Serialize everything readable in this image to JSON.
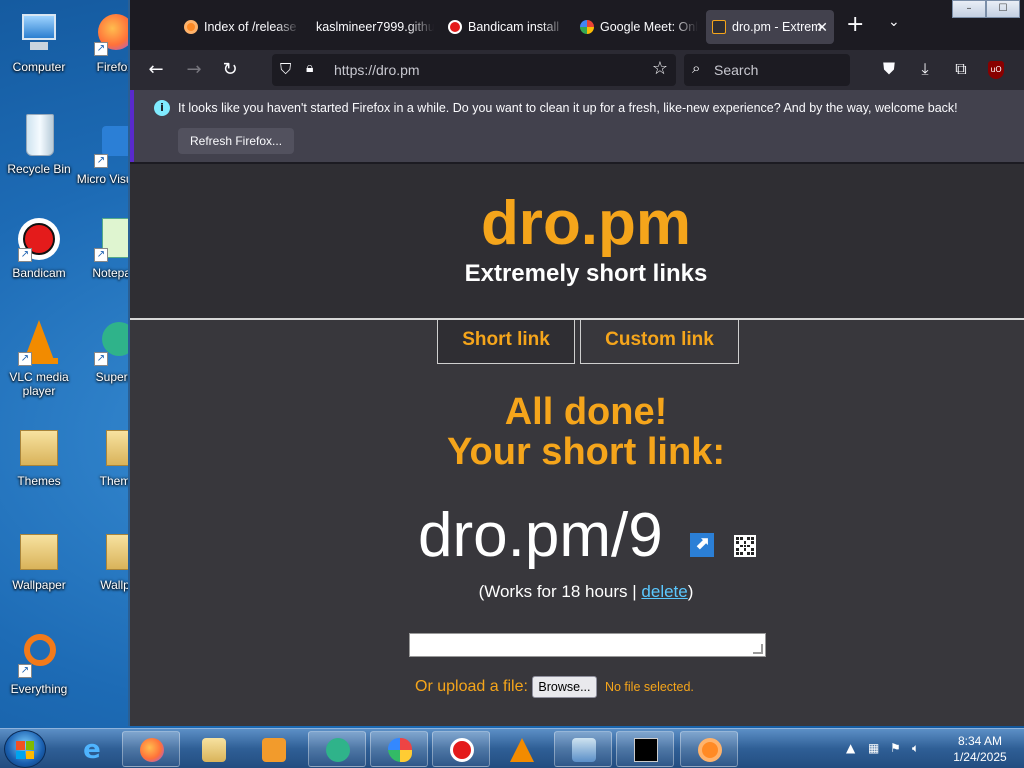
{
  "desktop": {
    "icons": [
      {
        "label": "Computer"
      },
      {
        "label": "Firefox"
      },
      {
        "label": "Recycle Bin"
      },
      {
        "label": "Micro Visual S"
      },
      {
        "label": "Bandicam"
      },
      {
        "label": "Notepad"
      },
      {
        "label": "VLC media player"
      },
      {
        "label": "Supern"
      },
      {
        "label": "Themes"
      },
      {
        "label": "Them"
      },
      {
        "label": "Wallpaper"
      },
      {
        "label": "Wallp"
      },
      {
        "label": "Everything"
      }
    ]
  },
  "browser": {
    "tabs": [
      {
        "label": "Index of /release"
      },
      {
        "label": "kaslmineer7999.githu"
      },
      {
        "label": "Bandicam install"
      },
      {
        "label": "Google Meet: Onl"
      },
      {
        "label": "dro.pm - Extrem"
      }
    ],
    "url": "https://dro.pm",
    "search_placeholder": "Search",
    "notice": {
      "message": "It looks like you haven't started Firefox in a while. Do you want to clean it up for a fresh, like-new experience? And by the way, welcome back!",
      "button": "Refresh Firefox..."
    },
    "ublock_label": "uO"
  },
  "page": {
    "logo": "dro.pm",
    "tagline": "Extremely short links",
    "tabs": {
      "short": "Short link",
      "custom": "Custom link"
    },
    "done_line1": "All done!",
    "done_line2": "Your short link:",
    "short_link": "dro.pm/9",
    "works_prefix": "(Works for 18 hours | ",
    "delete_label": "delete",
    "works_suffix": ")",
    "upload_label": "Or upload a file:",
    "browse_label": "Browse...",
    "no_file": "No file selected."
  },
  "taskbar": {
    "time": "8:34 AM",
    "date": "1/24/2025"
  },
  "colors": {
    "accent": "#f5a51b",
    "link": "#5bc8ff",
    "page_bg": "#38373c"
  }
}
